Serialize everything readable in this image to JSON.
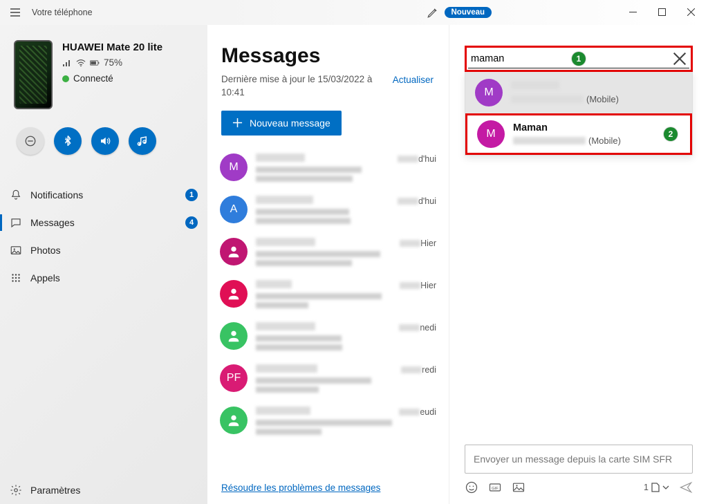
{
  "titlebar": {
    "title": "Votre téléphone",
    "new_pill": "Nouveau"
  },
  "phone": {
    "name": "HUAWEI Mate 20 lite",
    "battery_text": "75%",
    "status": "Connecté"
  },
  "nav": {
    "notifications": {
      "label": "Notifications",
      "badge": "1"
    },
    "messages": {
      "label": "Messages",
      "badge": "4"
    },
    "photos": {
      "label": "Photos"
    },
    "calls": {
      "label": "Appels"
    }
  },
  "settings_label": "Paramètres",
  "messages": {
    "title": "Messages",
    "subtitle": "Dernière mise à jour le 15/03/2022 à 10:41",
    "refresh": "Actualiser",
    "new_message": "Nouveau message",
    "troubleshoot": "Résoudre les problèmes de messages",
    "items": [
      {
        "avatar_letter": "M",
        "avatar_color": "#a03bc6",
        "time_suffix": "d'hui"
      },
      {
        "avatar_letter": "A",
        "avatar_color": "#2f7ddc",
        "time_suffix": "d'hui"
      },
      {
        "avatar_letter": "",
        "avatar_color": "#c01672",
        "person_icon": true,
        "time_suffix": "Hier"
      },
      {
        "avatar_letter": "",
        "avatar_color": "#e00f55",
        "person_icon": true,
        "time_suffix": "Hier"
      },
      {
        "avatar_letter": "",
        "avatar_color": "#38c363",
        "person_icon": true,
        "time_suffix": "nedi"
      },
      {
        "avatar_letter": "PF",
        "avatar_color": "#d91b74",
        "time_suffix": "redi"
      },
      {
        "avatar_letter": "",
        "avatar_color": "#38c363",
        "person_icon": true,
        "time_suffix": "eudi"
      }
    ]
  },
  "search": {
    "value": "maman",
    "annotation1": "1",
    "results": [
      {
        "avatar_letter": "M",
        "avatar_color": "#a03bc6",
        "name_redacted": true,
        "sub_suffix": "(Mobile)",
        "selected": true
      },
      {
        "avatar_letter": "M",
        "avatar_color": "#c41aa4",
        "name": "Maman",
        "sub_suffix": "(Mobile)",
        "highlighted": true,
        "annotation": "2"
      }
    ]
  },
  "compose": {
    "placeholder": "Envoyer un message depuis la carte SIM SFR",
    "sim_label": "1"
  }
}
